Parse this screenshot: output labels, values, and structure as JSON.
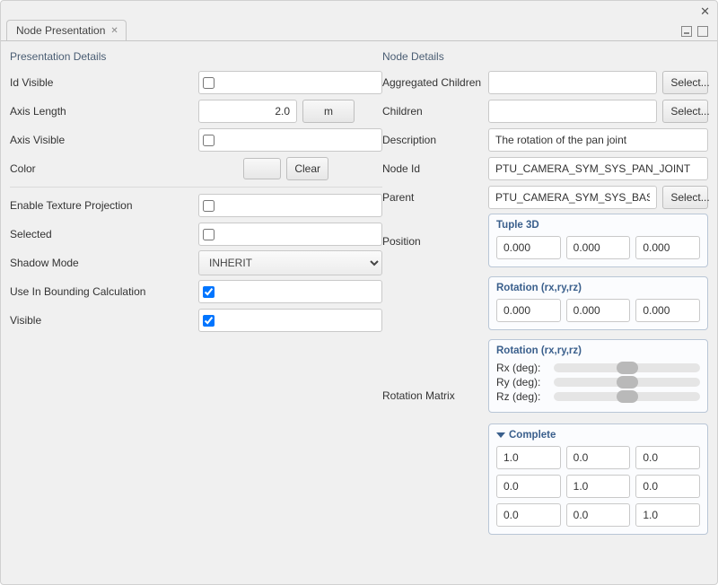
{
  "window": {
    "title": "Node Presentation"
  },
  "left": {
    "section_title": "Presentation Details",
    "id_visible_label": "Id Visible",
    "id_visible_checked": false,
    "axis_length_label": "Axis Length",
    "axis_length_value": "2.0",
    "axis_length_unit": "m",
    "axis_visible_label": "Axis Visible",
    "axis_visible_checked": false,
    "color_label": "Color",
    "color_clear_label": "Clear",
    "enable_tex_proj_label": "Enable Texture Projection",
    "enable_tex_proj_checked": false,
    "selected_label": "Selected",
    "selected_checked": false,
    "shadow_mode_label": "Shadow Mode",
    "shadow_mode_value": "INHERIT",
    "use_bounding_label": "Use In Bounding Calculation",
    "use_bounding_checked": true,
    "visible_label": "Visible",
    "visible_checked": true
  },
  "right": {
    "section_title": "Node Details",
    "select_button_label": "Select...",
    "agg_children_label": "Aggregated Children",
    "agg_children_value": "",
    "children_label": "Children",
    "children_value": "",
    "description_label": "Description",
    "description_value": "The rotation of the pan joint",
    "node_id_label": "Node Id",
    "node_id_value": "PTU_CAMERA_SYM_SYS_PAN_JOINT",
    "parent_label": "Parent",
    "parent_value": "PTU_CAMERA_SYM_SYS_BASE_T…",
    "position_label": "Position",
    "rotation_matrix_label": "Rotation Matrix",
    "tuple3d_title": "Tuple 3D",
    "tuple3d": [
      "0.000",
      "0.000",
      "0.000"
    ],
    "rotation_title": "Rotation (rx,ry,rz)",
    "rotation": [
      "0.000",
      "0.000",
      "0.000"
    ],
    "rotation_deg_title": "Rotation (rx,ry,rz)",
    "rx_label": "Rx (deg):",
    "ry_label": "Ry (deg):",
    "rz_label": "Rz (deg):",
    "complete_title": "Complete",
    "matrix": [
      [
        "1.0",
        "0.0",
        "0.0"
      ],
      [
        "0.0",
        "1.0",
        "0.0"
      ],
      [
        "0.0",
        "0.0",
        "1.0"
      ]
    ]
  }
}
